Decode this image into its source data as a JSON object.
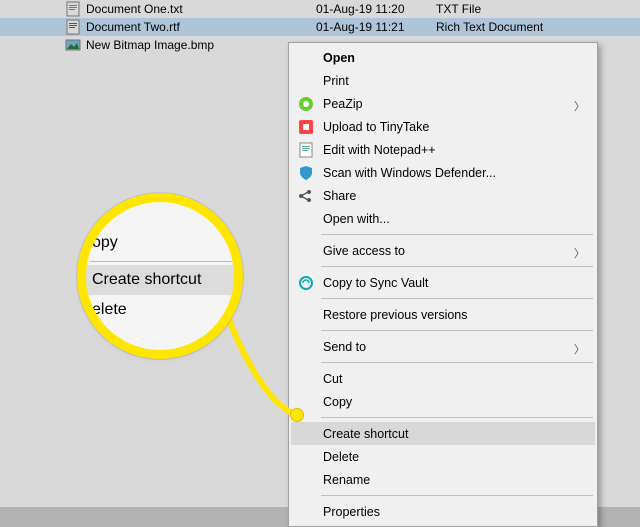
{
  "files": [
    {
      "name": "Document One.txt",
      "date": "01-Aug-19 11:20",
      "type": "TXT File"
    },
    {
      "name": "Document Two.rtf",
      "date": "01-Aug-19 11:21",
      "type": "Rich Text Document"
    },
    {
      "name": "New Bitmap Image.bmp",
      "date": "",
      "type": ""
    }
  ],
  "menu": {
    "open": "Open",
    "print": "Print",
    "peazip": "PeaZip",
    "tinytake": "Upload to TinyTake",
    "notepadpp": "Edit with Notepad++",
    "defender": "Scan with Windows Defender...",
    "share": "Share",
    "openwith": "Open with...",
    "giveaccess": "Give access to",
    "syncvault": "Copy to Sync Vault",
    "restore": "Restore previous versions",
    "sendto": "Send to",
    "cut": "Cut",
    "copy": "Copy",
    "createshortcut": "Create shortcut",
    "delete": "Delete",
    "rename": "Rename",
    "properties": "Properties"
  },
  "callout": {
    "copy": "opy",
    "createshortcut": "Create shortcut",
    "delete": "elete"
  }
}
